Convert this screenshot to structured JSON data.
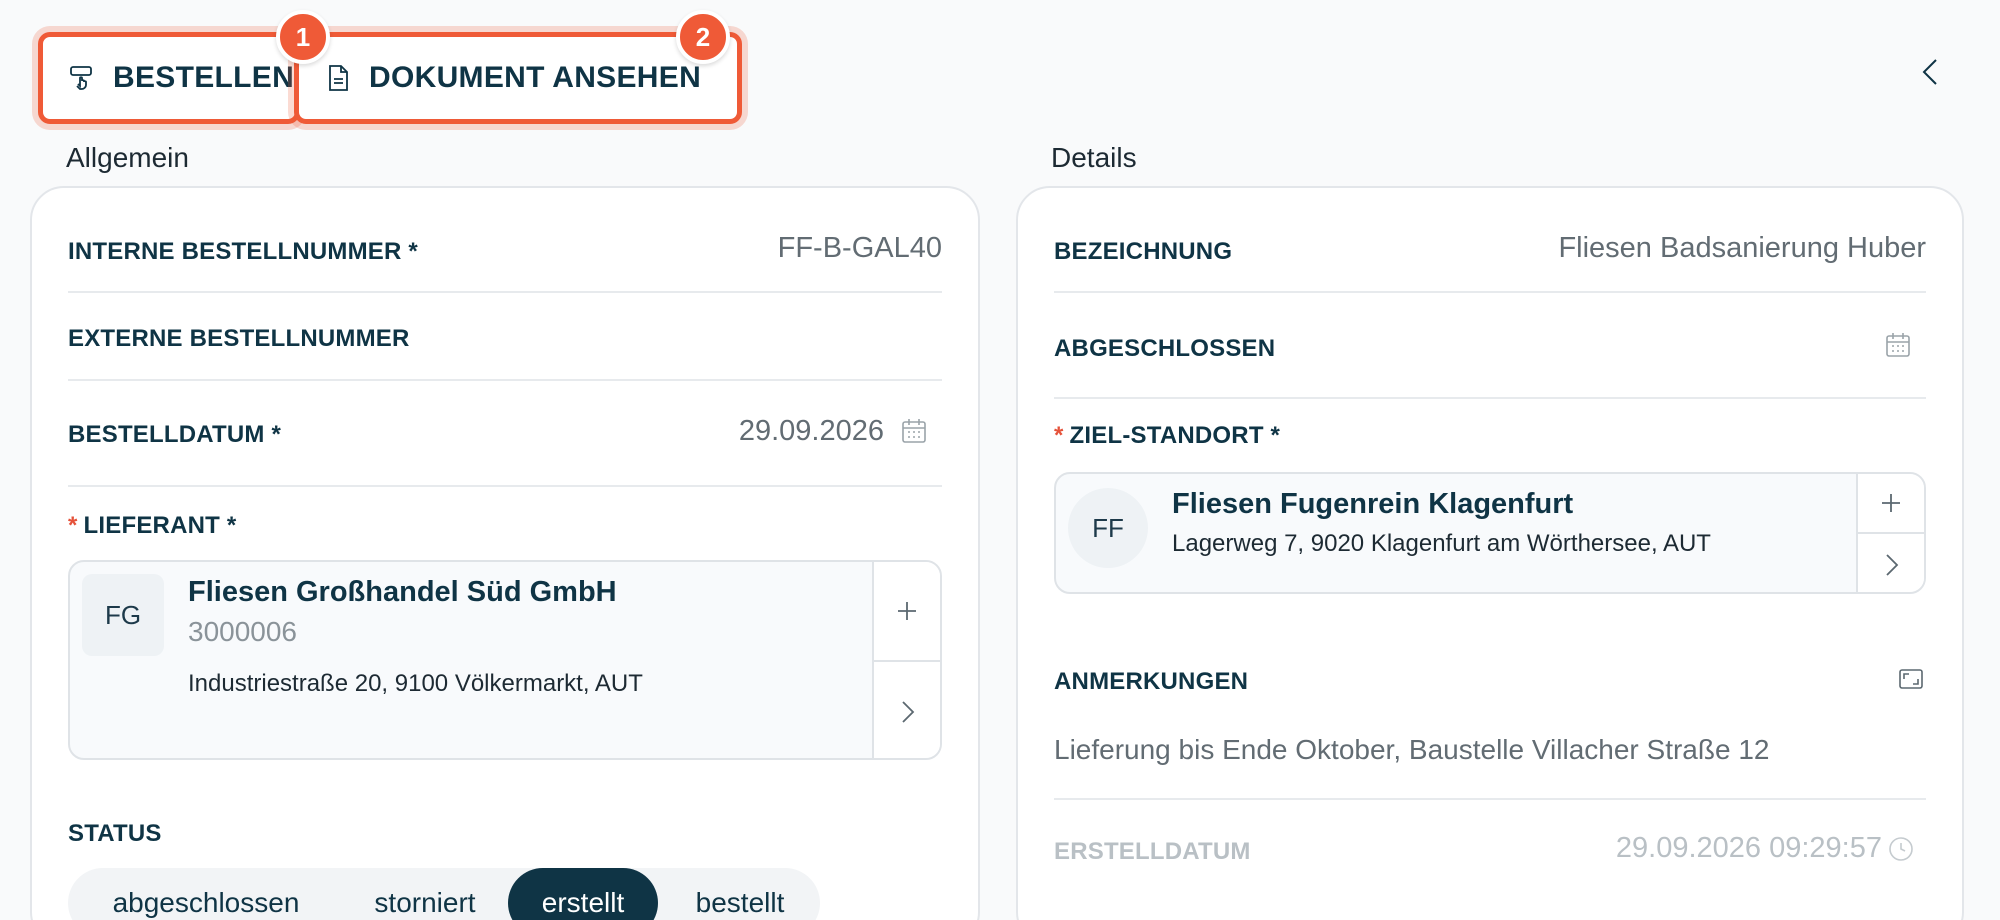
{
  "toolbar": {
    "order_label": "BESTELLEN",
    "view_doc_label": "DOKUMENT ANSEHEN",
    "badge_1": "1",
    "badge_2": "2",
    "icons": {
      "order": "touch-order-icon",
      "document": "document-icon",
      "collapse": "chevron-left-icon"
    }
  },
  "general": {
    "title": "Allgemein",
    "internal_no_label": "INTERNE BESTELLNUMMER *",
    "internal_no_value": "FF-B-GAL40",
    "external_no_label": "EXTERNE BESTELLNUMMER",
    "order_date_label": "BESTELLDATUM *",
    "order_date_value": "29.09.2026",
    "supplier_label": "LIEFERANT *",
    "supplier": {
      "initials": "FG",
      "name": "Fliesen Großhandel Süd GmbH",
      "number": "3000006",
      "address": "Industriestraße 20, 9100 Völkermarkt, AUT"
    },
    "status_label": "STATUS",
    "status_options": [
      "abgeschlossen",
      "storniert",
      "erstellt",
      "bestellt"
    ],
    "status_selected": "erstellt"
  },
  "details": {
    "title": "Details",
    "designation_label": "BEZEICHNUNG",
    "designation_value": "Fliesen Badsanierung Huber",
    "completed_label": "ABGESCHLOSSEN",
    "target_label": "ZIEL-STANDORT *",
    "target": {
      "initials": "FF",
      "name": "Fliesen Fugenrein Klagenfurt",
      "address": "Lagerweg 7, 9020 Klagenfurt am Wörthersee, AUT"
    },
    "notes_label": "ANMERKUNGEN",
    "notes_value": "Lieferung bis Ende Oktober, Baustelle Villacher Straße 12",
    "created_label": "ERSTELLDATUM",
    "created_value": "29.09.2026 09:29:57"
  },
  "colors": {
    "accent": "#ef5a37",
    "primary": "#0f3445",
    "required": "#e5523a"
  }
}
